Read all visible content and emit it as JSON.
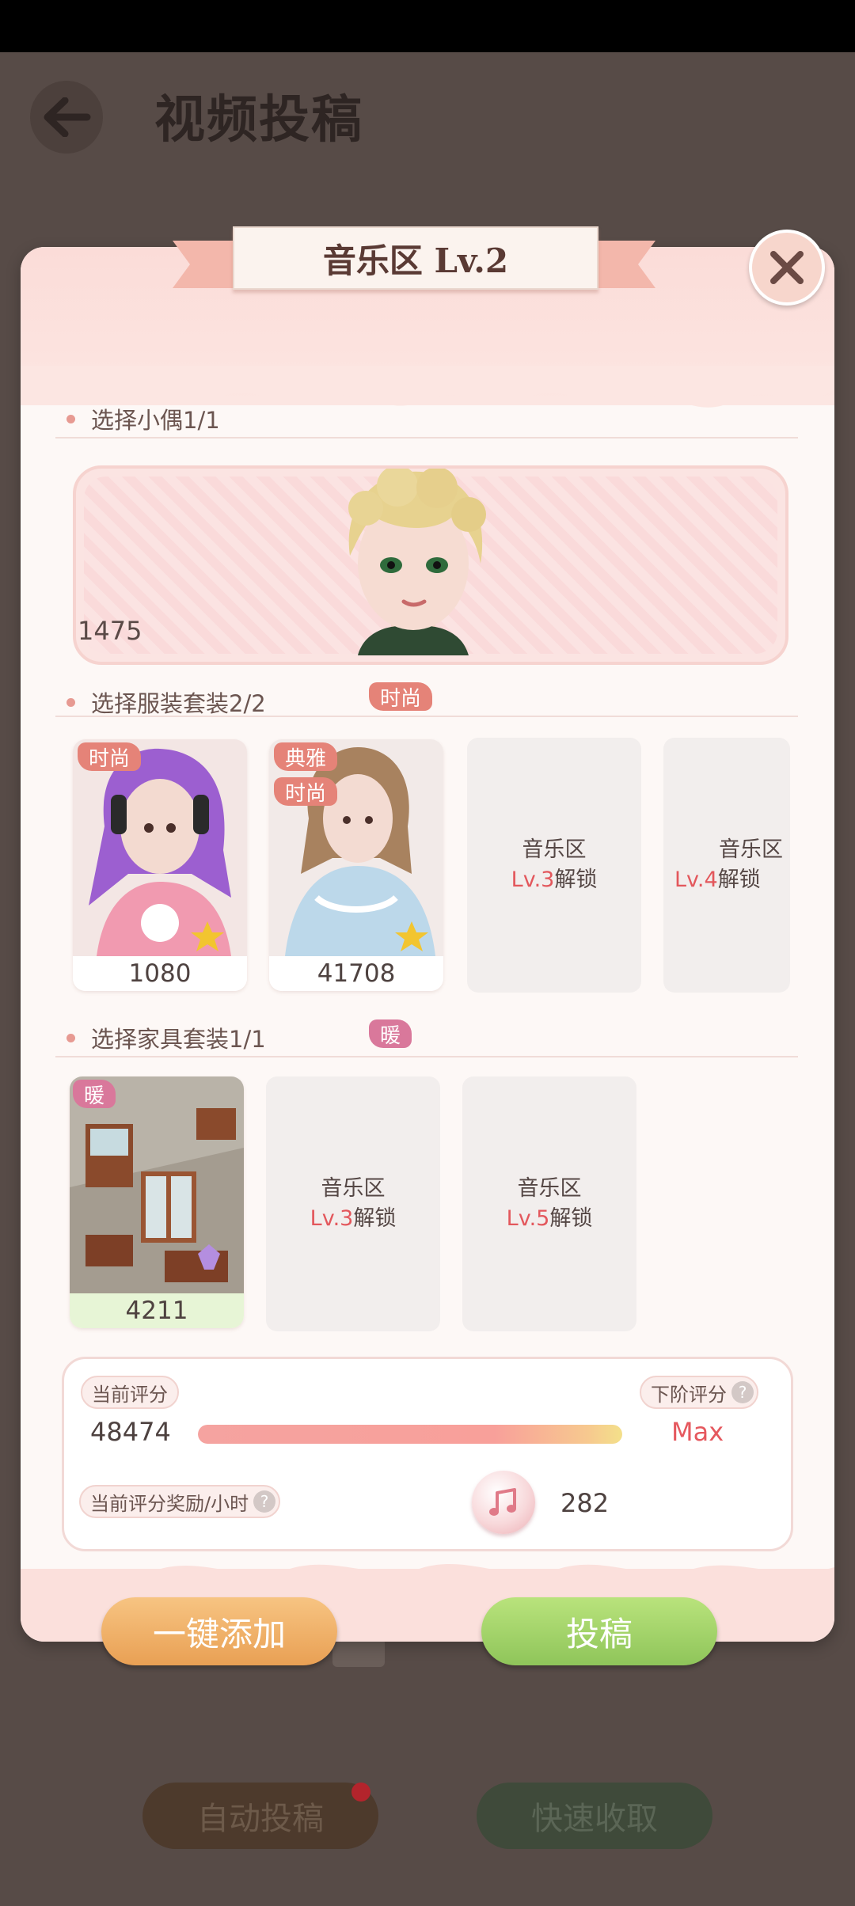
{
  "page": {
    "title": "视频投稿"
  },
  "dialog": {
    "title": "音乐区 Lv.2",
    "sections": {
      "character": {
        "label": "选择小偶1/1",
        "score": "1475"
      },
      "outfit": {
        "label": "选择服装套装2/2",
        "tag": "时尚",
        "cards": [
          {
            "tags": [
              "时尚"
            ],
            "score": "1080"
          },
          {
            "tags": [
              "典雅",
              "时尚"
            ],
            "score": "41708"
          }
        ],
        "locked": [
          {
            "zone": "音乐区",
            "level": "Lv.3",
            "suffix": "解锁"
          },
          {
            "zone": "音乐区",
            "level": "Lv.4",
            "suffix": "解锁"
          }
        ]
      },
      "furniture": {
        "label": "选择家具套装1/1",
        "tag": "暖",
        "cards": [
          {
            "tags": [
              "暖"
            ],
            "score": "4211"
          }
        ],
        "locked": [
          {
            "zone": "音乐区",
            "level": "Lv.3",
            "suffix": "解锁"
          },
          {
            "zone": "音乐区",
            "level": "Lv.5",
            "suffix": "解锁"
          }
        ]
      }
    },
    "score": {
      "current_label": "当前评分",
      "current_value": "48474",
      "next_label": "下阶评分",
      "next_value": "Max",
      "progress": 1.0,
      "reward_label": "当前评分奖励/小时",
      "reward_value": "282",
      "help_icon": "?"
    },
    "buttons": {
      "add": "一键添加",
      "submit": "投稿"
    }
  },
  "background_buttons": {
    "auto": "自动投稿",
    "quick": "快速收取"
  },
  "colors": {
    "accent_red": "#e5585e",
    "tag_red": "#e58378",
    "tag_pink": "#d9789b",
    "btn_orange": "#e9a054",
    "btn_green": "#8fc55a"
  }
}
